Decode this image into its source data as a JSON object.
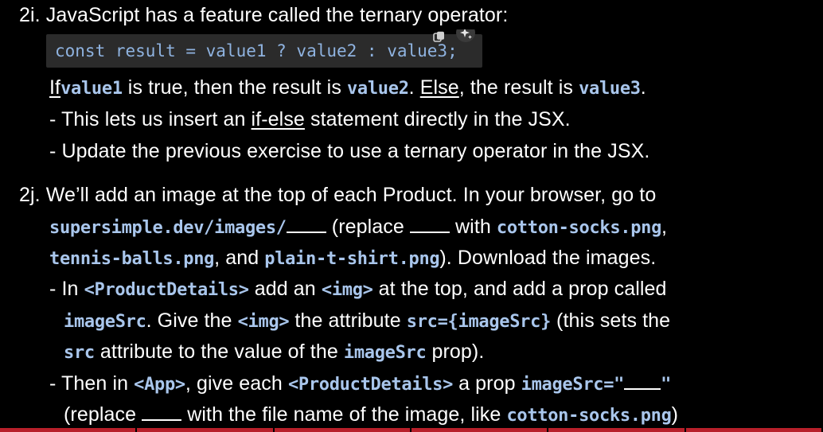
{
  "s2i": {
    "heading": "2i. JavaScript has a feature called the ternary operator:",
    "code_line": "const result = value1 ? value2 : value3;",
    "l2": {
      "if": "If",
      "c1": "value1",
      "t1": " is true, then the result is ",
      "c2": "value2",
      "t2": ". ",
      "else": "Else",
      "t3": ", the result is ",
      "c3": "value3",
      "t4": "."
    },
    "l3": {
      "t1": "- This lets us insert an ",
      "u": "if-else",
      "t2": " statement directly in the JSX."
    },
    "l4": "- Update the previous exercise to use a ternary operator in the JSX."
  },
  "s2j": {
    "l1": "2j. We’ll add an image at the top of each Product. In your browser, go to",
    "l2": {
      "c1": "supersimple.dev/images/",
      "t1": " (replace ",
      "t2": " with ",
      "c2": "cotton-socks.png",
      "t3": ","
    },
    "l3": {
      "c1": "tennis-balls.png",
      "t1": ", and ",
      "c2": "plain-t-shirt.png",
      "t2": "). Download the images."
    },
    "l4": {
      "t1": "- In ",
      "c1": "<ProductDetails>",
      "t2": " add an ",
      "c2": "<img>",
      "t3": " at the top, and add a prop called"
    },
    "l5": {
      "c1": "imageSrc",
      "t1": ". Give the ",
      "c2": "<img>",
      "t2": " the attribute ",
      "c3": "src={imageSrc}",
      "t3": " (this sets the"
    },
    "l6": {
      "c1": "src",
      "t1": " attribute to the value of the ",
      "c2": "imageSrc",
      "t2": " prop)."
    },
    "l7": {
      "t1": "- Then in ",
      "c1": "<App>",
      "t2": ", give each ",
      "c2": "<ProductDetails>",
      "t3": " a prop ",
      "c3": "imageSrc=\"",
      "c4": "\""
    },
    "l8": {
      "t1": "(replace ",
      "t2": " with the file name of the image, like ",
      "c1": "cotton-socks.png",
      "t3": ")"
    }
  },
  "icons": {
    "copy": "copy-icon",
    "sparkle": "sparkle-icon"
  },
  "colors": {
    "background": "#000000",
    "text": "#ffffff",
    "code": "#a9c6ec",
    "code_box": "#2b2b2b",
    "bottom_bar": "#b81f2a"
  }
}
